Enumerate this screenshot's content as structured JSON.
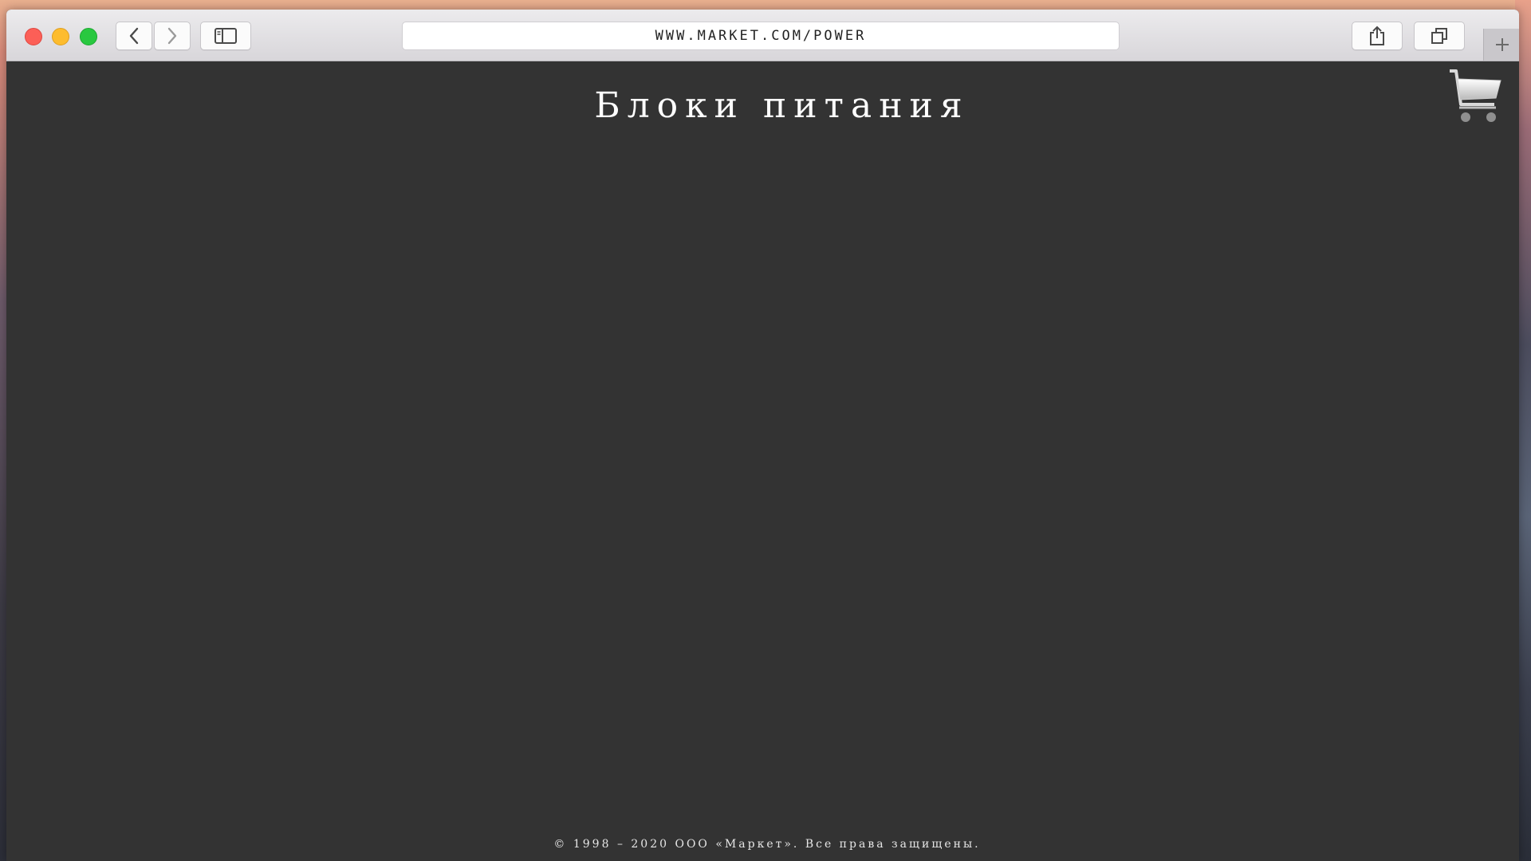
{
  "browser": {
    "url": "WWW.MARKET.COM/POWER"
  },
  "page": {
    "title": "Блоки питания",
    "footer": "© 1998 – 2020 ООО «Маркет». Все права защищены."
  },
  "icons": {
    "back": "chevron-left-icon",
    "forward": "chevron-right-icon",
    "sidebar": "sidebar-icon",
    "share": "share-icon",
    "tabs": "tabs-overview-icon",
    "new_tab": "plus-icon",
    "cart": "shopping-cart-icon"
  },
  "colors": {
    "page_background": "#333333",
    "title_text": "#ffffff",
    "close": "#fc5f57",
    "minimize": "#fdbc2e",
    "maximize": "#29c840"
  }
}
